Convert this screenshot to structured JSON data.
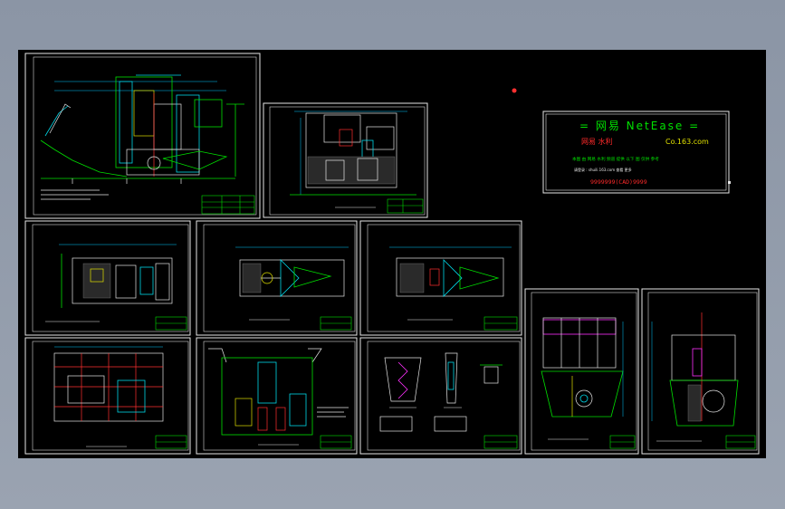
{
  "watermark": {
    "title": "= 网易 NetEase =",
    "brand": "网易 水利",
    "url": "Co.163.com",
    "line1": "本图 由 网易 水利 频道 提供 以下 图 仅供 参考",
    "line2": "请登录 : shuili.163.com 查看 更多",
    "code": "9999999(CAD)9999"
  },
  "colors": {
    "background": "#000000",
    "frame": "#e6e6e6",
    "green": "#00e000",
    "cyan": "#00d8e8",
    "red": "#ff3030",
    "magenta": "#ff30ff",
    "yellow": "#e0e000"
  }
}
